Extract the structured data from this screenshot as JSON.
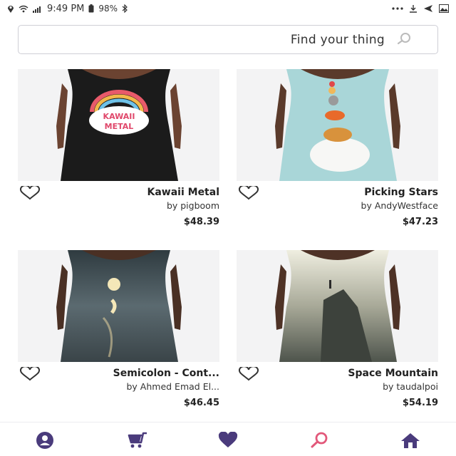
{
  "status_bar": {
    "time": "9:49 PM",
    "battery": "98%",
    "icons": [
      "location-icon",
      "wifi-icon",
      "signal-icon",
      "bluetooth-icon",
      "battery-icon",
      "more-icon",
      "download-icon",
      "send-icon",
      "image-icon"
    ]
  },
  "search": {
    "placeholder": "Find your thing",
    "icon": "search-icon"
  },
  "products": [
    {
      "title": "Picking Stars",
      "artist": "by AndyWestface",
      "price": "$47.23",
      "image_colors": {
        "bg": "#a9d3d6",
        "dress": "#a7d4d6"
      }
    },
    {
      "title": "Kawaii Metal",
      "artist": "by pigboom",
      "price": "$48.39",
      "image_colors": {
        "bg": "#f3f3f4",
        "dress": "#1a1a1a"
      }
    },
    {
      "title": "Space Mountain",
      "artist": "by taudalpoi",
      "price": "$54.19",
      "image_colors": {
        "bg": "#f3f3f4",
        "dress": "#6f7569"
      }
    },
    {
      "title": "Semicolon - Cont...",
      "artist": "by Ahmed Emad El...",
      "price": "$46.45",
      "image_colors": {
        "bg": "#f3f3f4",
        "dress": "#4a5760"
      }
    }
  ],
  "nav": {
    "items": [
      "home-icon",
      "search-icon",
      "heart-icon",
      "cart-icon",
      "account-icon"
    ],
    "colors": {
      "accent": "#4a3b7c",
      "active": "#e2587a"
    }
  }
}
